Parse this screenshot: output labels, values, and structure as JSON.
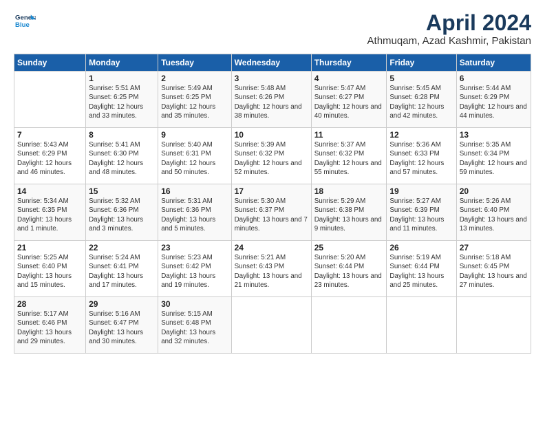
{
  "header": {
    "logo_line1": "General",
    "logo_line2": "Blue",
    "title": "April 2024",
    "subtitle": "Athmuqam, Azad Kashmir, Pakistan"
  },
  "weekdays": [
    "Sunday",
    "Monday",
    "Tuesday",
    "Wednesday",
    "Thursday",
    "Friday",
    "Saturday"
  ],
  "weeks": [
    [
      {
        "day": "",
        "sunrise": "",
        "sunset": "",
        "daylight": ""
      },
      {
        "day": "1",
        "sunrise": "Sunrise: 5:51 AM",
        "sunset": "Sunset: 6:25 PM",
        "daylight": "Daylight: 12 hours and 33 minutes."
      },
      {
        "day": "2",
        "sunrise": "Sunrise: 5:49 AM",
        "sunset": "Sunset: 6:25 PM",
        "daylight": "Daylight: 12 hours and 35 minutes."
      },
      {
        "day": "3",
        "sunrise": "Sunrise: 5:48 AM",
        "sunset": "Sunset: 6:26 PM",
        "daylight": "Daylight: 12 hours and 38 minutes."
      },
      {
        "day": "4",
        "sunrise": "Sunrise: 5:47 AM",
        "sunset": "Sunset: 6:27 PM",
        "daylight": "Daylight: 12 hours and 40 minutes."
      },
      {
        "day": "5",
        "sunrise": "Sunrise: 5:45 AM",
        "sunset": "Sunset: 6:28 PM",
        "daylight": "Daylight: 12 hours and 42 minutes."
      },
      {
        "day": "6",
        "sunrise": "Sunrise: 5:44 AM",
        "sunset": "Sunset: 6:29 PM",
        "daylight": "Daylight: 12 hours and 44 minutes."
      }
    ],
    [
      {
        "day": "7",
        "sunrise": "Sunrise: 5:43 AM",
        "sunset": "Sunset: 6:29 PM",
        "daylight": "Daylight: 12 hours and 46 minutes."
      },
      {
        "day": "8",
        "sunrise": "Sunrise: 5:41 AM",
        "sunset": "Sunset: 6:30 PM",
        "daylight": "Daylight: 12 hours and 48 minutes."
      },
      {
        "day": "9",
        "sunrise": "Sunrise: 5:40 AM",
        "sunset": "Sunset: 6:31 PM",
        "daylight": "Daylight: 12 hours and 50 minutes."
      },
      {
        "day": "10",
        "sunrise": "Sunrise: 5:39 AM",
        "sunset": "Sunset: 6:32 PM",
        "daylight": "Daylight: 12 hours and 52 minutes."
      },
      {
        "day": "11",
        "sunrise": "Sunrise: 5:37 AM",
        "sunset": "Sunset: 6:32 PM",
        "daylight": "Daylight: 12 hours and 55 minutes."
      },
      {
        "day": "12",
        "sunrise": "Sunrise: 5:36 AM",
        "sunset": "Sunset: 6:33 PM",
        "daylight": "Daylight: 12 hours and 57 minutes."
      },
      {
        "day": "13",
        "sunrise": "Sunrise: 5:35 AM",
        "sunset": "Sunset: 6:34 PM",
        "daylight": "Daylight: 12 hours and 59 minutes."
      }
    ],
    [
      {
        "day": "14",
        "sunrise": "Sunrise: 5:34 AM",
        "sunset": "Sunset: 6:35 PM",
        "daylight": "Daylight: 13 hours and 1 minute."
      },
      {
        "day": "15",
        "sunrise": "Sunrise: 5:32 AM",
        "sunset": "Sunset: 6:36 PM",
        "daylight": "Daylight: 13 hours and 3 minutes."
      },
      {
        "day": "16",
        "sunrise": "Sunrise: 5:31 AM",
        "sunset": "Sunset: 6:36 PM",
        "daylight": "Daylight: 13 hours and 5 minutes."
      },
      {
        "day": "17",
        "sunrise": "Sunrise: 5:30 AM",
        "sunset": "Sunset: 6:37 PM",
        "daylight": "Daylight: 13 hours and 7 minutes."
      },
      {
        "day": "18",
        "sunrise": "Sunrise: 5:29 AM",
        "sunset": "Sunset: 6:38 PM",
        "daylight": "Daylight: 13 hours and 9 minutes."
      },
      {
        "day": "19",
        "sunrise": "Sunrise: 5:27 AM",
        "sunset": "Sunset: 6:39 PM",
        "daylight": "Daylight: 13 hours and 11 minutes."
      },
      {
        "day": "20",
        "sunrise": "Sunrise: 5:26 AM",
        "sunset": "Sunset: 6:40 PM",
        "daylight": "Daylight: 13 hours and 13 minutes."
      }
    ],
    [
      {
        "day": "21",
        "sunrise": "Sunrise: 5:25 AM",
        "sunset": "Sunset: 6:40 PM",
        "daylight": "Daylight: 13 hours and 15 minutes."
      },
      {
        "day": "22",
        "sunrise": "Sunrise: 5:24 AM",
        "sunset": "Sunset: 6:41 PM",
        "daylight": "Daylight: 13 hours and 17 minutes."
      },
      {
        "day": "23",
        "sunrise": "Sunrise: 5:23 AM",
        "sunset": "Sunset: 6:42 PM",
        "daylight": "Daylight: 13 hours and 19 minutes."
      },
      {
        "day": "24",
        "sunrise": "Sunrise: 5:21 AM",
        "sunset": "Sunset: 6:43 PM",
        "daylight": "Daylight: 13 hours and 21 minutes."
      },
      {
        "day": "25",
        "sunrise": "Sunrise: 5:20 AM",
        "sunset": "Sunset: 6:44 PM",
        "daylight": "Daylight: 13 hours and 23 minutes."
      },
      {
        "day": "26",
        "sunrise": "Sunrise: 5:19 AM",
        "sunset": "Sunset: 6:44 PM",
        "daylight": "Daylight: 13 hours and 25 minutes."
      },
      {
        "day": "27",
        "sunrise": "Sunrise: 5:18 AM",
        "sunset": "Sunset: 6:45 PM",
        "daylight": "Daylight: 13 hours and 27 minutes."
      }
    ],
    [
      {
        "day": "28",
        "sunrise": "Sunrise: 5:17 AM",
        "sunset": "Sunset: 6:46 PM",
        "daylight": "Daylight: 13 hours and 29 minutes."
      },
      {
        "day": "29",
        "sunrise": "Sunrise: 5:16 AM",
        "sunset": "Sunset: 6:47 PM",
        "daylight": "Daylight: 13 hours and 30 minutes."
      },
      {
        "day": "30",
        "sunrise": "Sunrise: 5:15 AM",
        "sunset": "Sunset: 6:48 PM",
        "daylight": "Daylight: 13 hours and 32 minutes."
      },
      {
        "day": "",
        "sunrise": "",
        "sunset": "",
        "daylight": ""
      },
      {
        "day": "",
        "sunrise": "",
        "sunset": "",
        "daylight": ""
      },
      {
        "day": "",
        "sunrise": "",
        "sunset": "",
        "daylight": ""
      },
      {
        "day": "",
        "sunrise": "",
        "sunset": "",
        "daylight": ""
      }
    ]
  ]
}
